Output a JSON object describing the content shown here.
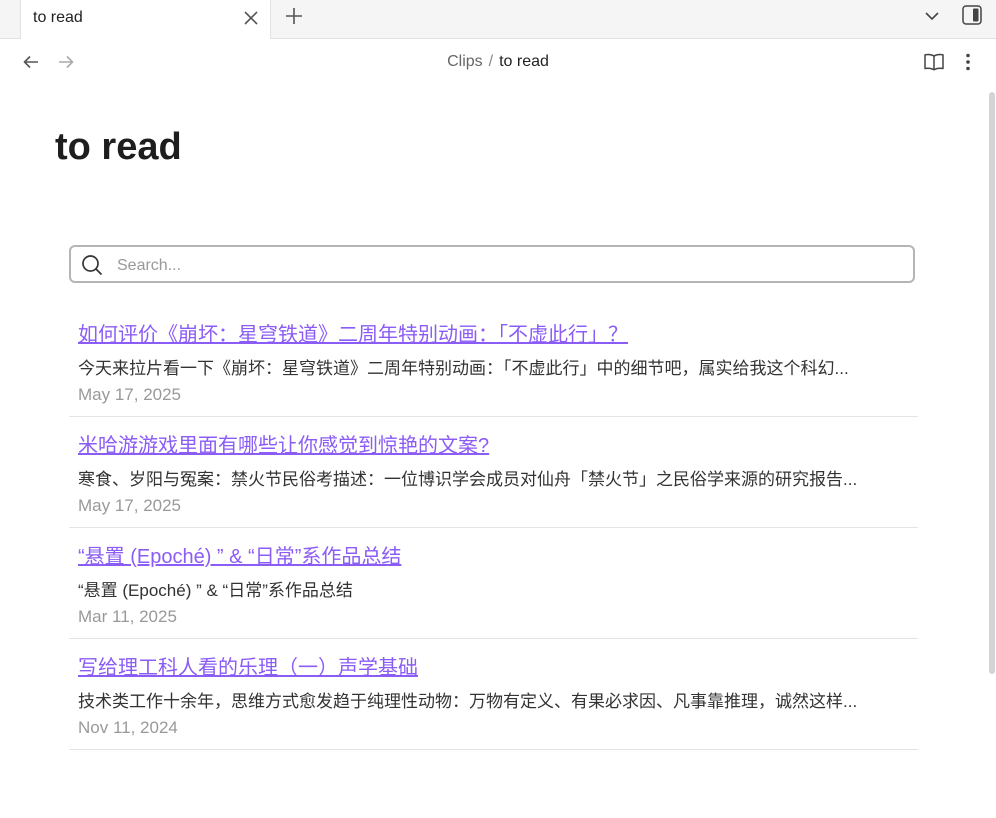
{
  "tabbar": {
    "active_tab_title": "to read"
  },
  "navbar": {
    "breadcrumb_parent": "Clips",
    "breadcrumb_separator": "/",
    "breadcrumb_current": "to read"
  },
  "page": {
    "title": "to read"
  },
  "search": {
    "placeholder": "Search...",
    "value": ""
  },
  "items": [
    {
      "title": "如何评价《崩坏：星穹铁道》二周年特别动画：「不虚此行」？",
      "excerpt": "今天来拉片看一下《崩坏：星穹铁道》二周年特别动画：「不虚此行」中的细节吧，属实给我这个科幻...",
      "date": "May 17, 2025"
    },
    {
      "title": "米哈游游戏里面有哪些让你感觉到惊艳的文案?",
      "excerpt": "寒食、岁阳与冤案：禁火节民俗考描述：一位博识学会成员对仙舟「禁火节」之民俗学来源的研究报告...",
      "date": "May 17, 2025"
    },
    {
      "title": "“悬置 (Epoché) ” & “日常”系作品总结",
      "excerpt": "“悬置 (Epoché) ” & “日常”系作品总结",
      "date": "Mar 11, 2025"
    },
    {
      "title": "写给理工科人看的乐理（一）声学基础",
      "excerpt": "技术类工作十余年，思维方式愈发趋于纯理性动物：万物有定义、有果必求因、凡事靠推理，诚然这样...",
      "date": "Nov 11, 2024"
    }
  ],
  "icons": {
    "close": "close-icon",
    "plus": "plus-icon",
    "chevron_down": "chevron-down-icon",
    "sidebar": "sidebar-toggle-icon",
    "back": "arrow-left-icon",
    "forward": "arrow-right-icon",
    "book": "book-open-icon",
    "more": "more-vertical-icon",
    "search": "search-icon"
  },
  "colors": {
    "link": "#8b5cf6",
    "muted": "#999999",
    "tabbar_bg": "#f5f5f5"
  }
}
